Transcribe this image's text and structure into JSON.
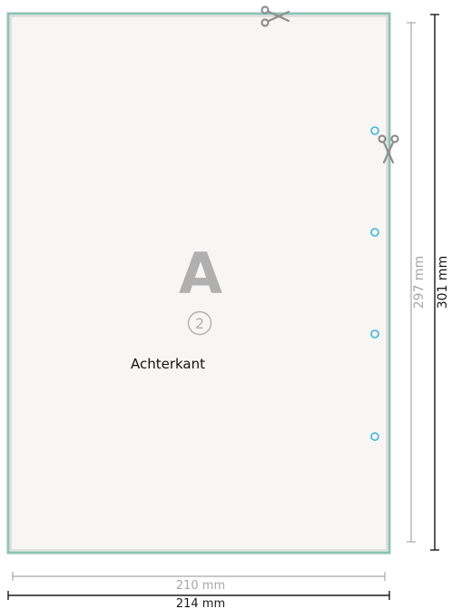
{
  "sheet": {
    "page_letter": "A",
    "page_number": "2",
    "side_label": "Achterkant"
  },
  "dimensions": {
    "inner_width": "210 mm",
    "outer_width": "214 mm",
    "inner_height": "297 mm",
    "outer_height": "301 mm"
  },
  "colors": {
    "sheet_fill": "#f7f6f4",
    "bleed_border": "#8fc3b6",
    "trim_border": "#b9b9b9",
    "hole": "#3bb4e0",
    "dim_inner": "#a6a6a6",
    "dim_outer": "#1a1a1a",
    "letter": "#b0b0b0",
    "scissors": "#8f8f8f"
  },
  "icons": {
    "cut_top": "scissors-icon",
    "cut_right": "scissors-icon",
    "holes": "punch-hole-icon"
  }
}
